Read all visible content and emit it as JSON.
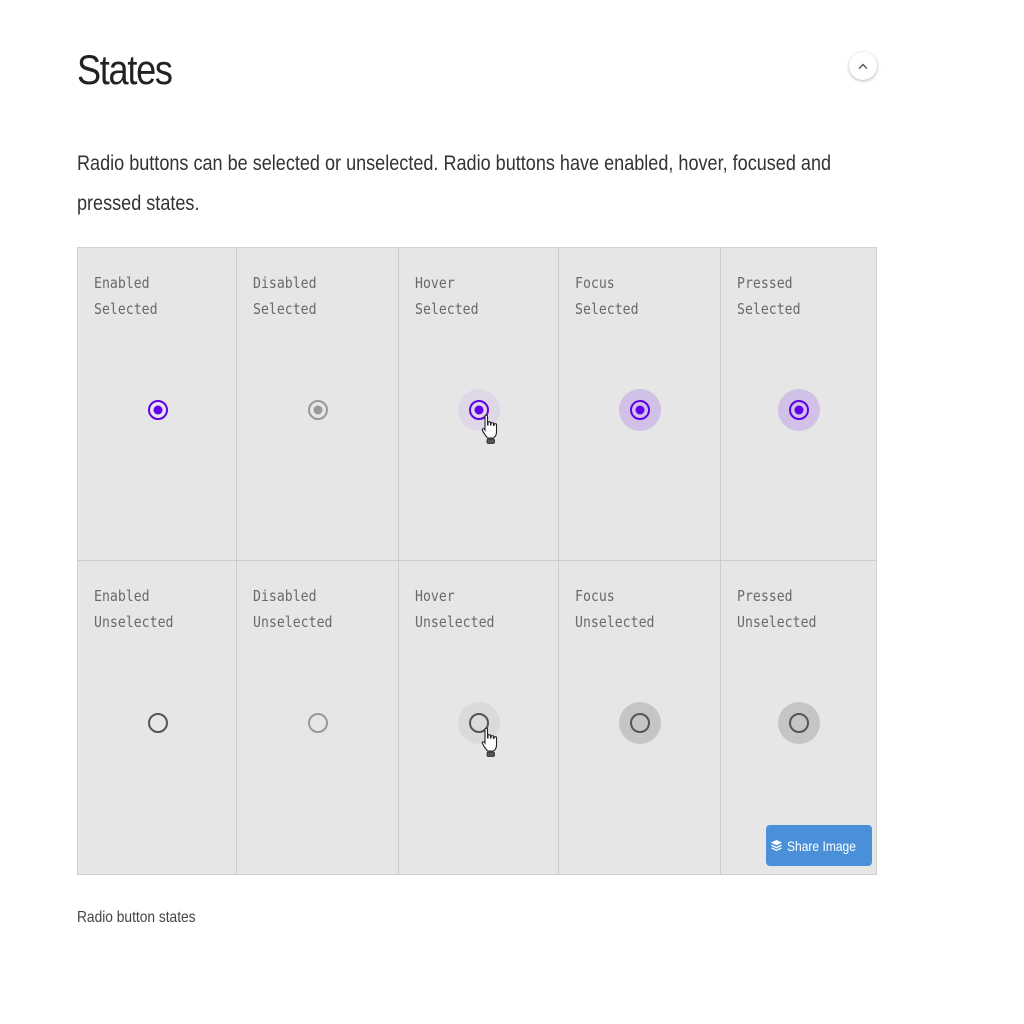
{
  "section": {
    "title": "States",
    "description": "Radio buttons can be selected or unselected. Radio buttons have enabled, hover, focused and pressed states.",
    "collapse_icon": "chevron-up-icon"
  },
  "colors": {
    "accent": "#6200ee",
    "disabled": "#999999",
    "unselected": "#555555",
    "figure_background": "#e6e6e6",
    "share_button": "#4a90d9"
  },
  "figure": {
    "caption": "Radio button states",
    "share_button": {
      "label": "Share Image",
      "icon": "layers-icon"
    },
    "rows": [
      {
        "cells": [
          {
            "line1": "Enabled",
            "line2": "Selected",
            "state": "enabled",
            "selected": true
          },
          {
            "line1": "Disabled",
            "line2": "Selected",
            "state": "disabled",
            "selected": true
          },
          {
            "line1": "Hover",
            "line2": "Selected",
            "state": "hover",
            "selected": true
          },
          {
            "line1": "Focus",
            "line2": "Selected",
            "state": "focus",
            "selected": true
          },
          {
            "line1": "Pressed",
            "line2": "Selected",
            "state": "pressed",
            "selected": true
          }
        ]
      },
      {
        "cells": [
          {
            "line1": "Enabled",
            "line2": "Unselected",
            "state": "enabled",
            "selected": false
          },
          {
            "line1": "Disabled",
            "line2": "Unselected",
            "state": "disabled",
            "selected": false
          },
          {
            "line1": "Hover",
            "line2": "Unselected",
            "state": "hover",
            "selected": false
          },
          {
            "line1": "Focus",
            "line2": "Unselected",
            "state": "focus",
            "selected": false
          },
          {
            "line1": "Pressed",
            "line2": "Unselected",
            "state": "pressed",
            "selected": false
          }
        ]
      }
    ]
  }
}
